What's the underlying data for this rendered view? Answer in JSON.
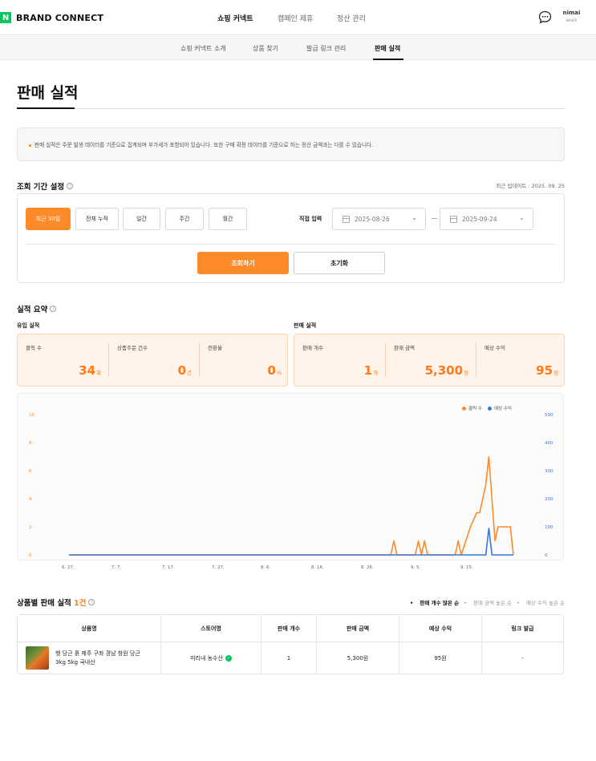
{
  "brand": {
    "logo_letter": "N",
    "name": "BRAND CONNECT"
  },
  "top_nav": [
    {
      "label": "쇼핑 커넥트",
      "active": true
    },
    {
      "label": "캠페인 제휴",
      "active": false
    },
    {
      "label": "정산 관리",
      "active": false
    }
  ],
  "user": {
    "avatar_text": "nimai",
    "avatar_sub": "NAVER"
  },
  "sub_nav": [
    {
      "label": "쇼핑 커넥트 소개",
      "active": false
    },
    {
      "label": "상품 찾기",
      "active": false
    },
    {
      "label": "발급 링크 관리",
      "active": false
    },
    {
      "label": "판매 실적",
      "active": true
    }
  ],
  "page_title": "판매 실적",
  "notice": "판매 실적은 주문 발생 데이터를 기준으로 집계되며 부가세가 포함되어 있습니다. 또한 구매 확정 데이터를 기준으로 하는 정산 금액과는 다를 수 있습니다.",
  "period": {
    "title": "조회 기간 설정",
    "last_update": "최근 업데이트 : 2025. 09. 25",
    "buttons": [
      "최근 30일",
      "전체 누적",
      "일간",
      "주간",
      "월간"
    ],
    "active_button": "최근 30일",
    "direct_input_label": "직접 입력",
    "start_date": "2025-08-26",
    "end_date": "2025-09-24",
    "search_label": "조회하기",
    "reset_label": "초기화"
  },
  "summary": {
    "title": "실적 요약",
    "inflow": {
      "label": "유입 실적",
      "metrics": [
        {
          "label": "클릭 수",
          "value": "34",
          "unit": "회"
        },
        {
          "label": "상품주문 건수",
          "value": "0",
          "unit": "건"
        },
        {
          "label": "전환율",
          "value": "0",
          "unit": "%"
        }
      ]
    },
    "sales": {
      "label": "판매 실적",
      "metrics": [
        {
          "label": "판매 개수",
          "value": "1",
          "unit": "개"
        },
        {
          "label": "판매 금액",
          "value": "5,300",
          "unit": "원"
        },
        {
          "label": "예상 수익",
          "value": "95",
          "unit": "원"
        }
      ]
    }
  },
  "chart_data": {
    "type": "line",
    "series": [
      {
        "name": "클릭 수",
        "color": "#ff8a2a",
        "axis": "left",
        "points": [
          [
            0,
            0
          ],
          [
            105,
            0
          ],
          [
            106,
            1
          ],
          [
            107,
            0
          ],
          [
            113,
            0
          ],
          [
            114,
            1
          ],
          [
            115,
            0
          ],
          [
            116,
            1
          ],
          [
            117,
            0
          ],
          [
            126,
            0
          ],
          [
            127,
            1
          ],
          [
            128,
            0
          ],
          [
            131,
            2
          ],
          [
            133,
            3
          ],
          [
            134,
            3
          ],
          [
            136,
            5
          ],
          [
            137,
            7
          ],
          [
            139,
            1
          ],
          [
            140,
            2
          ],
          [
            141,
            2
          ],
          [
            144,
            2
          ],
          [
            145,
            0
          ]
        ]
      },
      {
        "name": "예상 수익",
        "color": "#3a78d8",
        "axis": "right",
        "points": [
          [
            0,
            0
          ],
          [
            136,
            0
          ],
          [
            137,
            95
          ],
          [
            138,
            0
          ],
          [
            145,
            0
          ]
        ]
      }
    ],
    "x_ticks": [
      "6. 27.",
      "7. 7.",
      "7. 17.",
      "7. 27.",
      "8. 6.",
      "8. 16.",
      "8. 26.",
      "9. 5.",
      "9. 15."
    ],
    "y_left_ticks": [
      "0",
      "2",
      "4",
      "6",
      "8",
      "10"
    ],
    "y_right_ticks": [
      "0",
      "100",
      "200",
      "300",
      "400",
      "500"
    ],
    "ylim_left": [
      0,
      10
    ],
    "ylim_right": [
      0,
      500
    ],
    "legend_position": "top-right",
    "grid": false
  },
  "products": {
    "title_prefix": "상품별 판매 실적",
    "count": "1건",
    "sort_options": [
      {
        "label": "판매 개수 많은 순",
        "active": true
      },
      {
        "label": "판매 금액 높은 순",
        "active": false
      },
      {
        "label": "예상 수익 높은 순",
        "active": false
      }
    ],
    "columns": [
      "상품명",
      "스토어명",
      "판매 개수",
      "판매 금액",
      "예상 수익",
      "링크 발급"
    ],
    "rows": [
      {
        "name": "햇 당근 흙 제주 구좌 경남 창원 당근 3kg 5kg 국내산",
        "store": "미리내 농수산",
        "qty": "1",
        "amount": "5,300원",
        "profit": "95원",
        "link": "-"
      }
    ]
  }
}
